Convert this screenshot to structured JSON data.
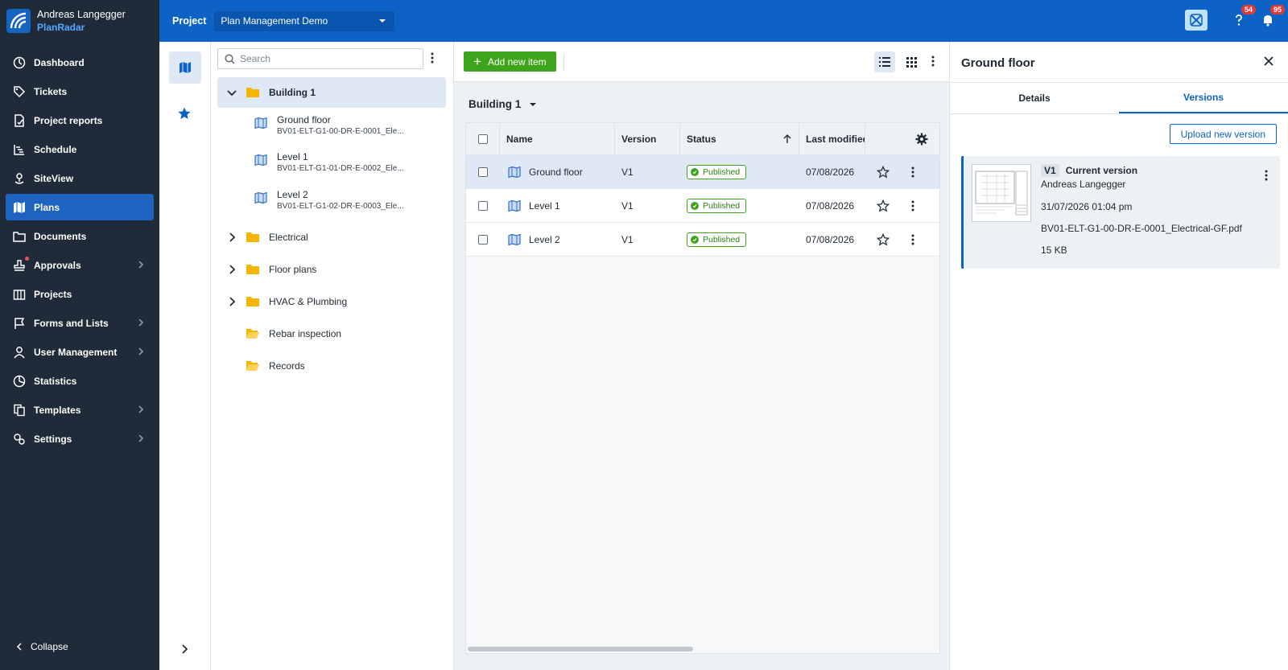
{
  "brand": {
    "user": "Andreas Langegger",
    "app": "PlanRadar"
  },
  "nav": {
    "items": [
      {
        "label": "Dashboard",
        "icon": "dashboard-icon"
      },
      {
        "label": "Tickets",
        "icon": "tag-icon"
      },
      {
        "label": "Project reports",
        "icon": "report-icon"
      },
      {
        "label": "Schedule",
        "icon": "schedule-icon"
      },
      {
        "label": "SiteView",
        "icon": "siteview-icon"
      },
      {
        "label": "Plans",
        "icon": "map-icon"
      },
      {
        "label": "Documents",
        "icon": "folder-icon"
      },
      {
        "label": "Approvals",
        "icon": "approval-icon"
      },
      {
        "label": "Projects",
        "icon": "projects-icon"
      },
      {
        "label": "Forms and Lists",
        "icon": "flag-icon"
      },
      {
        "label": "User Management",
        "icon": "user-icon"
      },
      {
        "label": "Statistics",
        "icon": "pie-icon"
      },
      {
        "label": "Templates",
        "icon": "templates-icon"
      },
      {
        "label": "Settings",
        "icon": "gear-icon"
      }
    ],
    "collapse_label": "Collapse"
  },
  "header": {
    "project_label": "Project",
    "project_value": "Plan Management Demo",
    "help_badge": "54",
    "notif_badge": "95"
  },
  "tree": {
    "search_placeholder": "Search",
    "root": "Building 1",
    "plans": [
      {
        "name": "Ground floor",
        "file": "BV01-ELT-G1-00-DR-E-0001_Ele..."
      },
      {
        "name": "Level 1",
        "file": "BV01-ELT-G1-01-DR-E-0002_Ele..."
      },
      {
        "name": "Level 2",
        "file": "BV01-ELT-G1-02-DR-E-0003_Ele..."
      }
    ],
    "folders": [
      "Electrical",
      "Floor plans",
      "HVAC & Plumbing",
      "Rebar inspection",
      "Records"
    ]
  },
  "main": {
    "add_label": "Add new item",
    "breadcrumb": "Building 1",
    "columns": {
      "name": "Name",
      "version": "Version",
      "status": "Status",
      "modified": "Last modified"
    },
    "rows": [
      {
        "name": "Ground floor",
        "version": "V1",
        "status": "Published",
        "modified": "07/08/2026"
      },
      {
        "name": "Level 1",
        "version": "V1",
        "status": "Published",
        "modified": "07/08/2026"
      },
      {
        "name": "Level 2",
        "version": "V1",
        "status": "Published",
        "modified": "07/08/2026"
      }
    ]
  },
  "panel": {
    "title": "Ground floor",
    "tabs": [
      "Details",
      "Versions"
    ],
    "upload_label": "Upload new version",
    "version": {
      "tag": "V1",
      "label": "Current version",
      "author": "Andreas Langegger",
      "date": "31/07/2026 01:04 pm",
      "file": "BV01-ELT-G1-00-DR-E-0001_Electrical-GF.pdf",
      "size": "15 KB"
    }
  },
  "colors": {
    "primary": "#0d62c6",
    "sidebar": "#1f2b38",
    "success": "#3da41b",
    "folder": "#f5b400"
  }
}
